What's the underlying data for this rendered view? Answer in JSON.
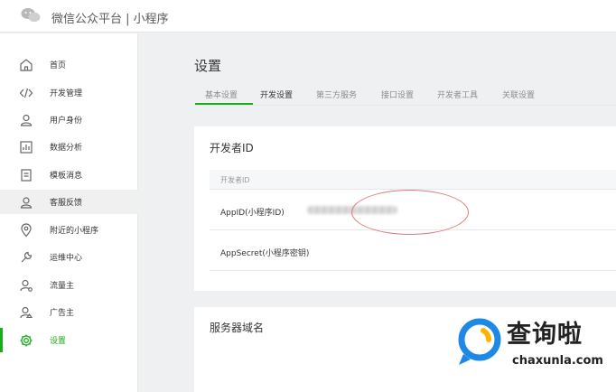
{
  "topbar": {
    "brand": "微信公众平台 | 小程序"
  },
  "sidebar": {
    "items": [
      {
        "label": "首页",
        "icon": "home-icon"
      },
      {
        "label": "开发管理",
        "icon": "code-icon"
      },
      {
        "label": "用户身份",
        "icon": "user-icon"
      },
      {
        "label": "数据分析",
        "icon": "chart-icon"
      },
      {
        "label": "模板消息",
        "icon": "template-icon"
      },
      {
        "label": "客服反馈",
        "icon": "support-icon"
      },
      {
        "label": "附近的小程序",
        "icon": "location-icon"
      },
      {
        "label": "运维中心",
        "icon": "wrench-icon"
      },
      {
        "label": "流量主",
        "icon": "traffic-user-icon"
      },
      {
        "label": "广告主",
        "icon": "advertiser-icon"
      },
      {
        "label": "设置",
        "icon": "gear-icon"
      }
    ],
    "active_index": 10,
    "hover_index": 5
  },
  "main": {
    "title": "设置",
    "tabs": [
      {
        "label": "基本设置"
      },
      {
        "label": "开发设置"
      },
      {
        "label": "第三方服务"
      },
      {
        "label": "接口设置"
      },
      {
        "label": "开发者工具"
      },
      {
        "label": "关联设置"
      }
    ],
    "active_tab": 1,
    "developer_card": {
      "title": "开发者ID",
      "header": "开发者ID",
      "rows": [
        {
          "label": "AppID(小程序ID)"
        },
        {
          "label": "AppSecret(小程序密钥)"
        }
      ]
    },
    "server_card": {
      "title": "服务器域名"
    }
  },
  "watermark": {
    "text": "查询啦",
    "url": "chaxunla.com"
  },
  "colors": {
    "accent": "#1aad19",
    "highlight": "#e07c7c",
    "watermark_blue": "#1e88e5"
  }
}
